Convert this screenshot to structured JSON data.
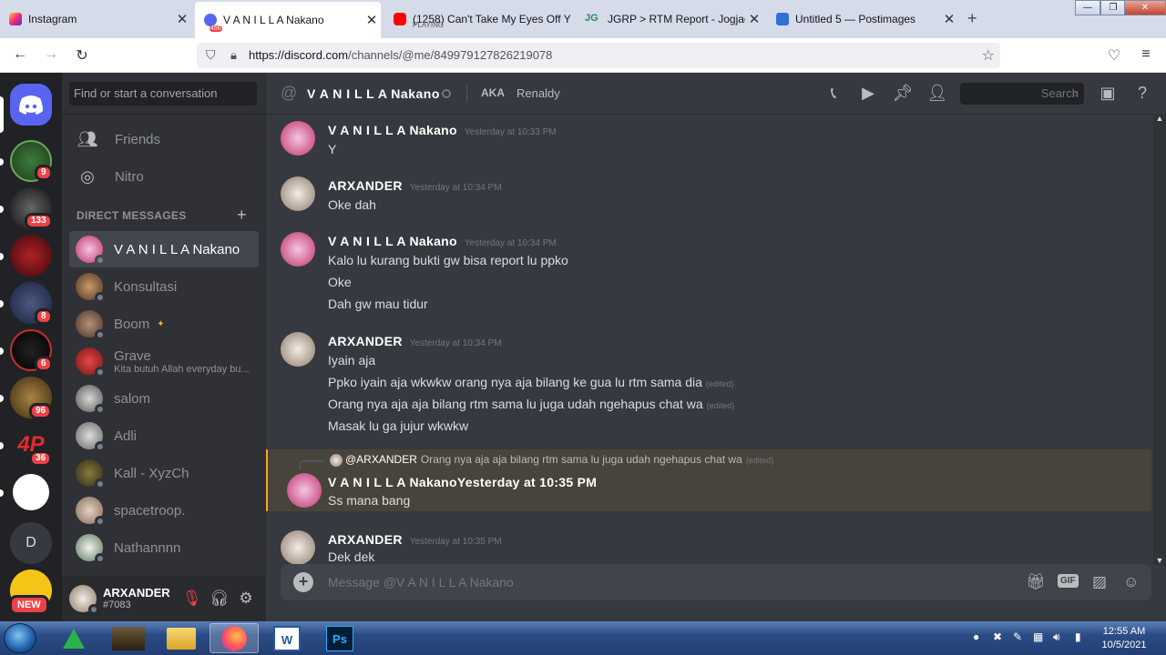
{
  "browser": {
    "tabs": [
      {
        "title": "Instagram",
        "sub": "",
        "color": "#c13584"
      },
      {
        "title": "V A N I L L A Nakano",
        "sub": "",
        "color": "#5865f2"
      },
      {
        "title": "(1258) Can't Take My Eyes Off Y",
        "sub": "PLAYING",
        "color": "#ff0000"
      },
      {
        "title": "JGRP > RTM Report - Jogjagam",
        "sub": "",
        "color": "#2e8b57"
      },
      {
        "title": "Untitled 5 — Postimages",
        "sub": "",
        "color": "#2f6fd6"
      }
    ],
    "tab_badge": "456",
    "url_domain": "https://discord.com",
    "url_path": "/channels/@me/849979127826219078"
  },
  "guilds": {
    "badges": [
      "9",
      "133",
      "8",
      "6",
      "96",
      "36"
    ],
    "letter": "D",
    "new_label": "NEW"
  },
  "sidebar": {
    "search_placeholder": "Find or start a conversation",
    "friends": "Friends",
    "nitro": "Nitro",
    "dm_header": "DIRECT MESSAGES",
    "dms": [
      {
        "name": "V A N I L L A Nakano",
        "sub": ""
      },
      {
        "name": "Konsultasi",
        "sub": ""
      },
      {
        "name": "Boom",
        "sub": ""
      },
      {
        "name": "Grave",
        "sub": "Kita butuh Allah everyday bu..."
      },
      {
        "name": "salom",
        "sub": ""
      },
      {
        "name": "Adli",
        "sub": ""
      },
      {
        "name": "Kall - XyzCh",
        "sub": ""
      },
      {
        "name": "spacetroop.",
        "sub": ""
      },
      {
        "name": "Nathannnn",
        "sub": ""
      }
    ]
  },
  "user": {
    "name": "ARXANDER",
    "tag": "#7083"
  },
  "chat": {
    "title": "V A N I L L A Nakano",
    "aka": "AKA",
    "nickname": "Renaldy",
    "search": "Search",
    "placeholder": "Message @V A N I L L A Nakano",
    "gif": "GIF",
    "edited": "(edited)",
    "messages": [
      {
        "author": "V A N I L L A Nakano",
        "time": "Yesterday at 10:33 PM",
        "lines": [
          "Y"
        ]
      },
      {
        "author": "ARXANDER",
        "time": "Yesterday at 10:34 PM",
        "lines": [
          "Oke dah"
        ]
      },
      {
        "author": "V A N I L L A Nakano",
        "time": "Yesterday at 10:34 PM",
        "lines": [
          "Kalo lu kurang bukti gw bisa report lu ppko",
          "Oke",
          "Dah gw mau tidur"
        ]
      },
      {
        "author": "ARXANDER",
        "time": "Yesterday at 10:34 PM",
        "lines": [
          "Iyain aja",
          "Ppko iyain aja wkwkw orang nya aja bilang ke gua lu rtm sama dia",
          "Orang nya aja aja bilang rtm sama lu juga udah ngehapus chat wa",
          "Masak lu ga jujur wkwkw"
        ]
      },
      {
        "author": "V A N I L L A Nakano",
        "time": "Yesterday at 10:35 PM",
        "lines": [
          "Ss mana bang"
        ],
        "reply_to": "@ARXANDER",
        "reply_text": "Orang nya aja aja bilang rtm sama lu juga udah ngehapus chat wa"
      },
      {
        "author": "ARXANDER",
        "time": "Yesterday at 10:35 PM",
        "lines": [
          "Dek dek"
        ]
      }
    ]
  },
  "taskbar": {
    "word": "W",
    "ps": "Ps",
    "time": "12:55 AM",
    "date": "10/5/2021"
  }
}
